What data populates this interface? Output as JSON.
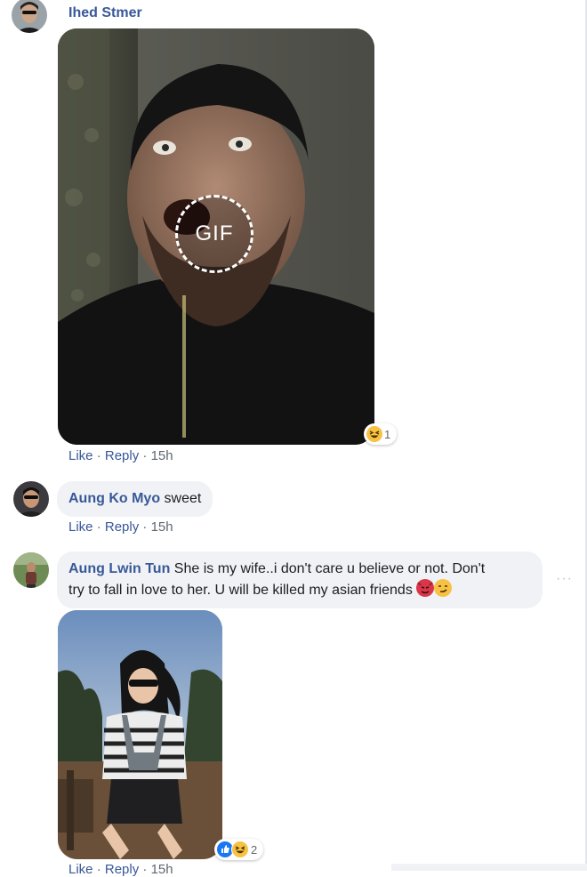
{
  "comments": [
    {
      "author": "Ihed Stmer",
      "media_label": "GIF",
      "reaction_count": "1",
      "actions": {
        "like": "Like",
        "reply": "Reply",
        "sep": "·",
        "time": "15h"
      }
    },
    {
      "author": "Aung Ko Myo",
      "text": "sweet",
      "actions": {
        "like": "Like",
        "reply": "Reply",
        "sep": "·",
        "time": "15h"
      }
    },
    {
      "author": "Aung Lwin Tun",
      "text_line1": "She is my wife..i don't care u believe or not. Don't",
      "text_line2": "try to fall in love to her. U will be killed my asian friends",
      "reaction_count": "2",
      "more": "···",
      "actions": {
        "like": "Like",
        "reply": "Reply",
        "sep": "·",
        "time": "15h"
      }
    }
  ],
  "colors": {
    "link": "#385898",
    "bubble": "#f0f2f5",
    "muted": "#606770"
  },
  "icons": [
    "haha-emoji-icon",
    "like-reaction-icon",
    "devil-emoji-icon",
    "smirk-emoji-icon",
    "gif-icon",
    "more-options-icon"
  ]
}
